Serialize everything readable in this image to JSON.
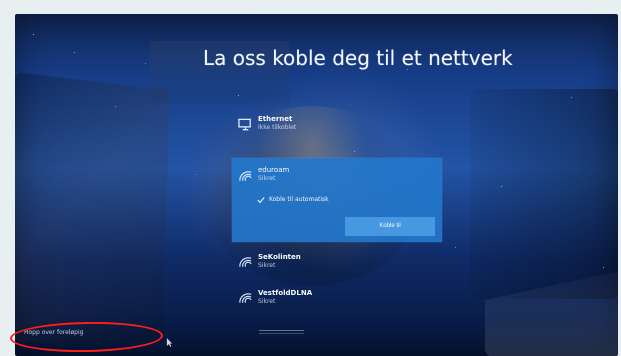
{
  "page": {
    "title": "La oss koble deg til et nettverk"
  },
  "networks": [
    {
      "name": "Ethernet",
      "status": "Ikke tilkoblet",
      "icon": "ethernet-monitor-icon"
    },
    {
      "name": "eduroam",
      "status": "Sikret",
      "icon": "wifi-icon",
      "selected": true,
      "auto_connect_label": "Koble til automatisk",
      "auto_connect_checked": true,
      "connect_button": "Koble til"
    },
    {
      "name": "SeKolinten",
      "status": "Sikret",
      "icon": "wifi-icon"
    },
    {
      "name": "VestfoldDLNA",
      "status": "Sikret",
      "icon": "wifi-icon"
    }
  ],
  "footer": {
    "skip_link": "Hopp over foreløpig"
  },
  "colors": {
    "screen_blue": "#2354a6",
    "selected_card": "#2378cd",
    "connect_button": "#499ae2",
    "highlight_red": "#ff1d1d"
  }
}
